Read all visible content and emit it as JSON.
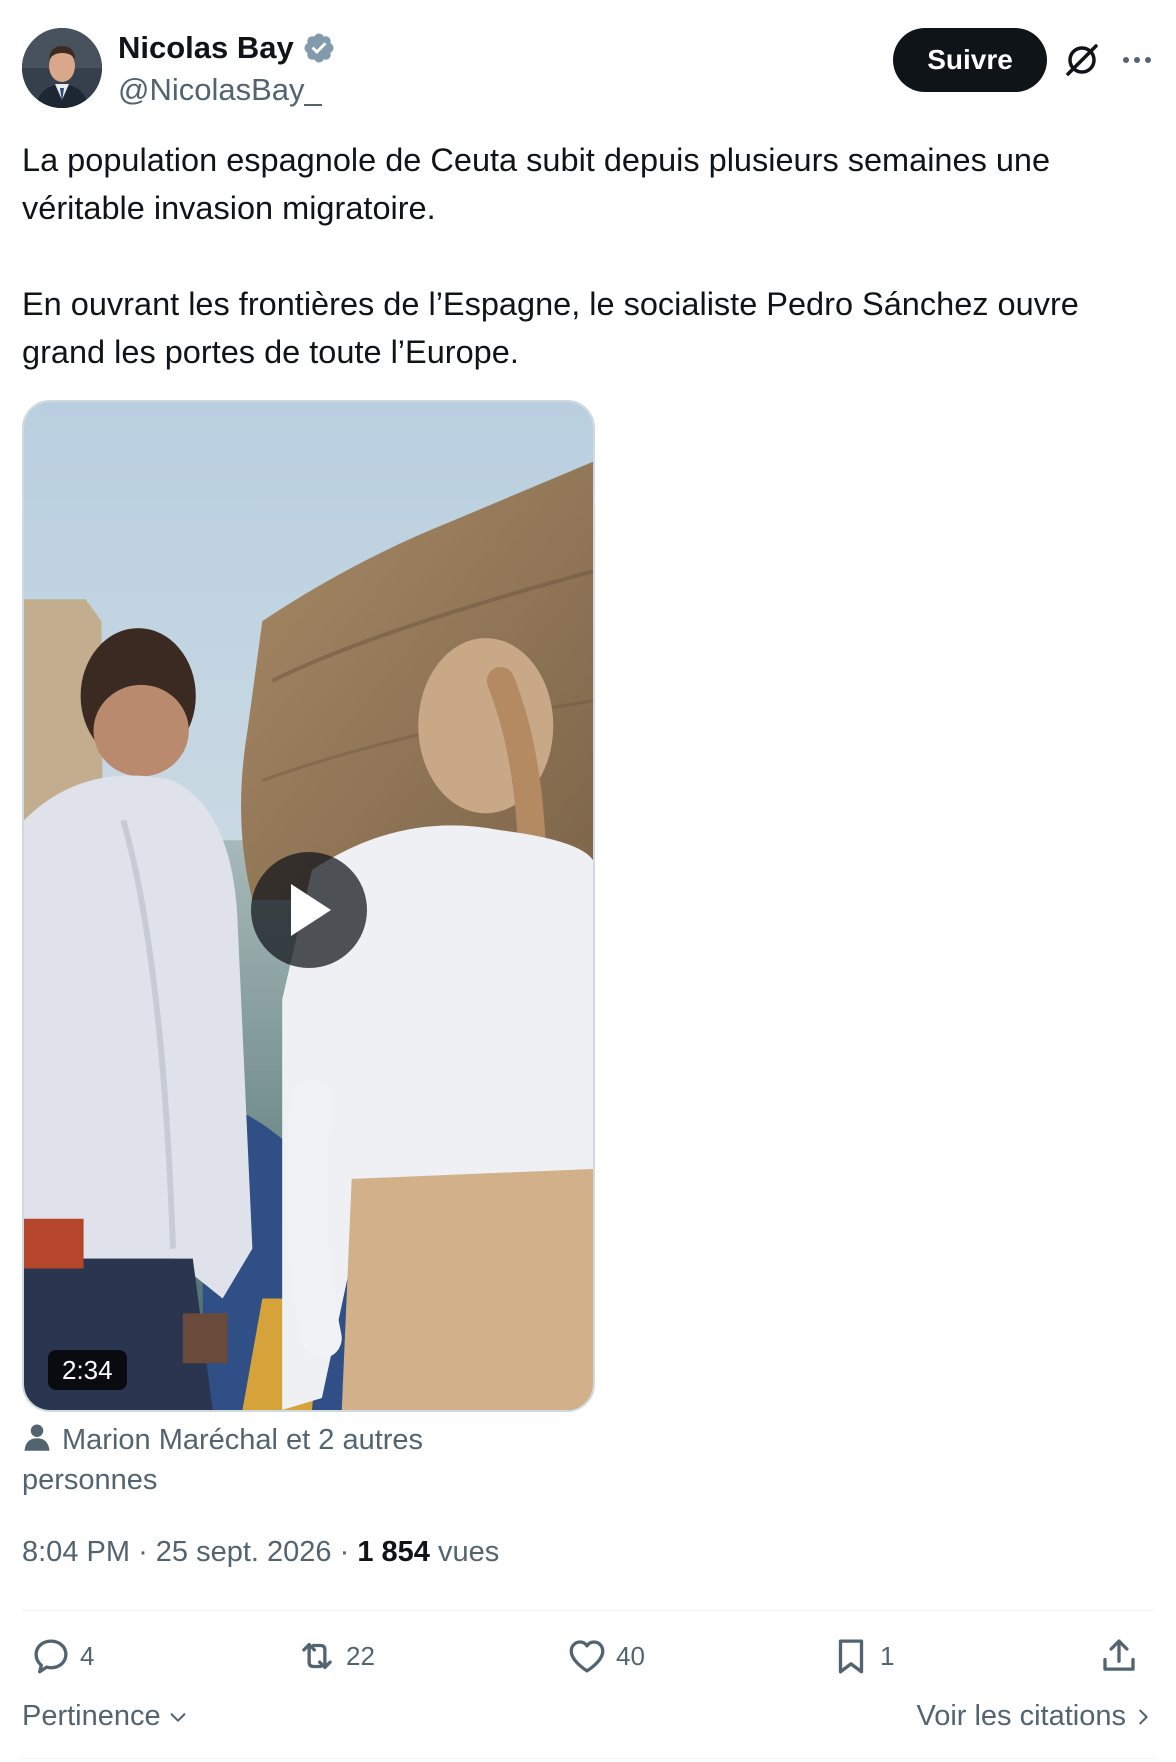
{
  "author": {
    "display_name": "Nicolas Bay",
    "handle": "@NicolasBay_",
    "verified": true,
    "avatar_icon": "profile-photo",
    "verified_color": "#829aab"
  },
  "header": {
    "follow_label": "Suivre",
    "grok_icon": "grok-icon",
    "more_icon": "more-icon"
  },
  "tweet": {
    "paragraph_1": "La population espagnole de Ceuta subit depuis plusieurs semaines une véritable invasion migratoire.",
    "paragraph_2": "En ouvrant les frontières de l’Espagne, le socialiste Pedro Sánchez ouvre grand les portes de toute l’Europe."
  },
  "media": {
    "type": "video",
    "duration": "2:34",
    "play_icon": "play-icon"
  },
  "tagged": {
    "icon": "person-icon",
    "text_line_1": "Marion Maréchal et 2 autres",
    "text_line_2": "personnes"
  },
  "meta": {
    "time": "8:04 PM",
    "date": "25 sept. 2026",
    "views_count": "1 854",
    "views_label": "vues",
    "separator": "·"
  },
  "actions": {
    "replies": "4",
    "reposts": "22",
    "likes": "40",
    "bookmarks": "1",
    "reply_icon": "reply-icon",
    "repost_icon": "repost-icon",
    "like_icon": "heart-icon",
    "bookmark_icon": "bookmark-icon",
    "share_icon": "share-icon"
  },
  "footer": {
    "sort_label": "Pertinence",
    "quotes_label": "Voir les citations"
  },
  "colors": {
    "text_primary": "#0f1419",
    "text_secondary": "#536471",
    "button_dark": "#0f1419",
    "border": "#eff3f4"
  }
}
